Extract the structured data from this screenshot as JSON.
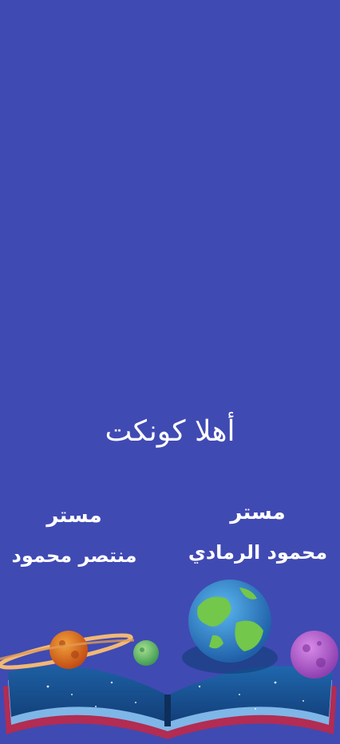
{
  "welcome_text": "أهلا كونكت",
  "contacts": [
    {
      "title": "مستر",
      "name": "منتصر محمود"
    },
    {
      "title": "مستر",
      "name": "محمود الرمادي"
    }
  ],
  "illustration": {
    "icon": "open-book-planets-icon"
  },
  "colors": {
    "background": "#404ab3",
    "text": "#ffffff"
  }
}
